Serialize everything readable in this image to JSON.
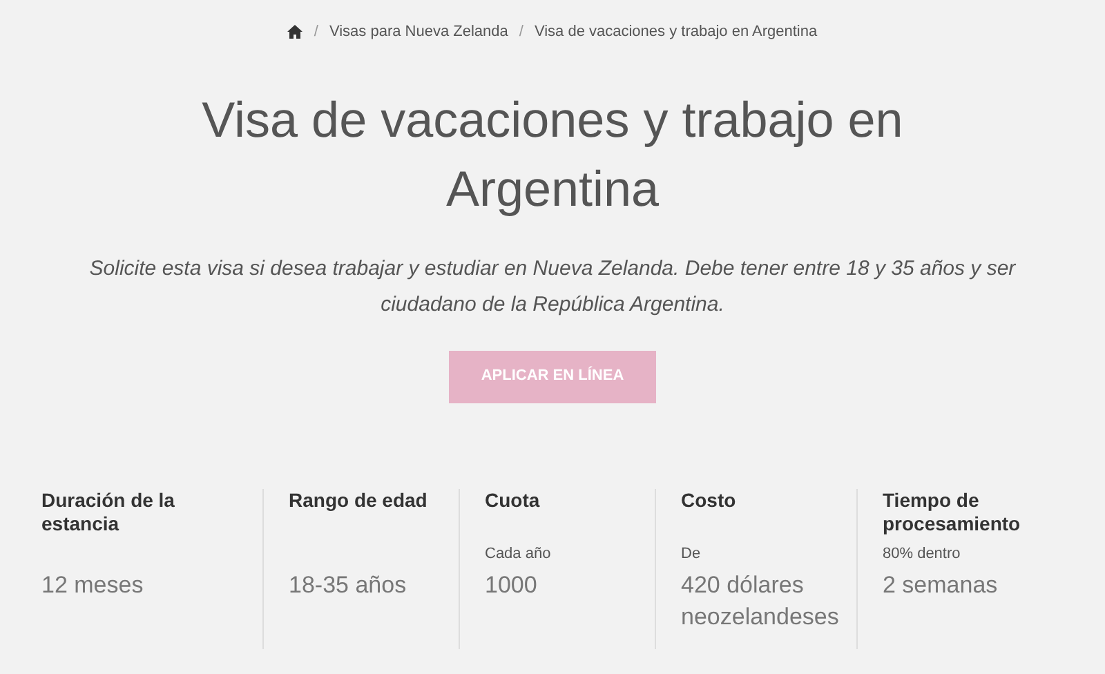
{
  "breadcrumb": [
    {
      "separator": "/",
      "label": "Visas para Nueva Zelanda"
    },
    {
      "separator": "/",
      "label": "Visa de vacaciones y trabajo en Argentina"
    }
  ],
  "title": "Visa de vacaciones y trabajo en Argentina",
  "intro": "Solicite esta visa si desea trabajar y estudiar en Nueva Zelanda. Debe tener entre 18 y 35 años y ser ciudadano de la República Argentina.",
  "apply_button": {
    "label": "APLICAR EN LÍNEA",
    "disabled": true
  },
  "facts": [
    {
      "label": "Duración de la estancia",
      "value": "12 meses"
    },
    {
      "label": "Rango de edad",
      "value": "18-35 años"
    },
    {
      "label": "Cuota",
      "note": "Cada año",
      "value": "1000"
    },
    {
      "label": "Costo",
      "note": "De",
      "value": "420 dólares neozelandeses"
    },
    {
      "label": "Tiempo de procesamiento",
      "note": "80% dentro",
      "value": "2 semanas"
    }
  ]
}
